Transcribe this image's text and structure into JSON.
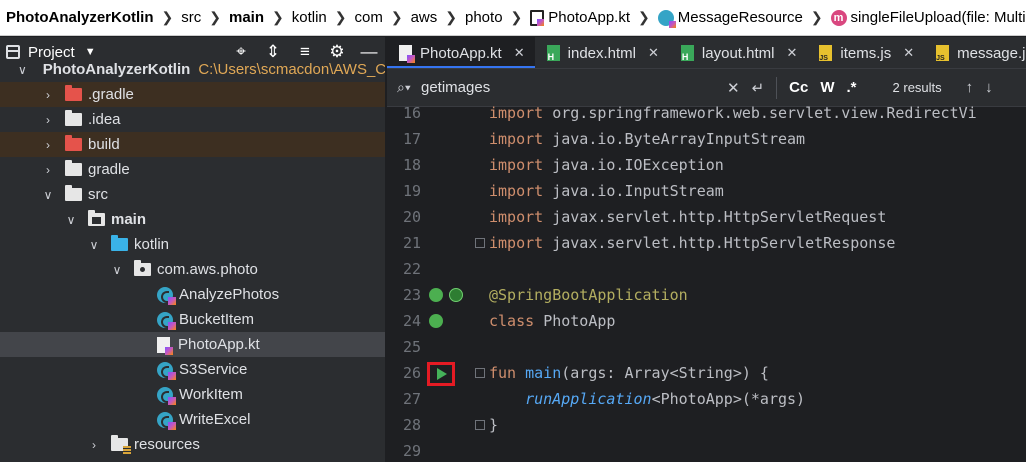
{
  "breadcrumb": {
    "project": "PhotoAnalyzerKotlin",
    "src": "src",
    "main": "main",
    "kotlin": "kotlin",
    "com": "com",
    "aws": "aws",
    "photo": "photo",
    "file": "PhotoApp.kt",
    "class": "MessageResource",
    "method_icon": "m",
    "method": "singleFileUpload(file: MultipartFile): M"
  },
  "project_panel": {
    "title": "Project",
    "tree": [
      {
        "label": "PhotoAnalyzerKotlin",
        "path": "C:\\Users\\scmacdon\\AWS_Co",
        "type": "root"
      },
      {
        "label": ".gradle",
        "type": "folder-red",
        "excluded": true
      },
      {
        "label": ".idea",
        "type": "folder-white"
      },
      {
        "label": "build",
        "type": "folder-red",
        "excluded": true
      },
      {
        "label": "gradle",
        "type": "folder-white"
      },
      {
        "label": "src",
        "type": "folder-white",
        "expanded": true
      },
      {
        "label": "main",
        "type": "folder-src",
        "expanded": true
      },
      {
        "label": "kotlin",
        "type": "folder-blue",
        "expanded": true
      },
      {
        "label": "com.aws.photo",
        "type": "folder-pkg",
        "expanded": true
      },
      {
        "label": "AnalyzePhotos",
        "type": "kt-class"
      },
      {
        "label": "BucketItem",
        "type": "kt-class"
      },
      {
        "label": "PhotoApp.kt",
        "type": "kt-file",
        "selected": true
      },
      {
        "label": "S3Service",
        "type": "kt-class"
      },
      {
        "label": "WorkItem",
        "type": "kt-class"
      },
      {
        "label": "WriteExcel",
        "type": "kt-class"
      },
      {
        "label": "resources",
        "type": "folder-res"
      }
    ]
  },
  "tabs": [
    {
      "label": "PhotoApp.kt",
      "icon": "kotlin-file-icon",
      "active": true
    },
    {
      "label": "index.html",
      "icon": "html-file-icon"
    },
    {
      "label": "layout.html",
      "icon": "html-file-icon"
    },
    {
      "label": "items.js",
      "icon": "js-file-icon"
    },
    {
      "label": "message.js",
      "icon": "js-file-icon"
    }
  ],
  "search": {
    "query": "getimages",
    "case_toggle": "Cc",
    "word_toggle": "W",
    "regex_toggle": ".*",
    "results": "2 results"
  },
  "code": {
    "lines": [
      {
        "n": "16",
        "parts": [
          [
            "kw",
            "import "
          ],
          [
            "",
            "org.springframework.web.servlet.view.RedirectVi"
          ]
        ]
      },
      {
        "n": "17",
        "parts": [
          [
            "kw",
            "import "
          ],
          [
            "",
            "java.io.ByteArrayInputStream"
          ]
        ]
      },
      {
        "n": "18",
        "parts": [
          [
            "kw",
            "import "
          ],
          [
            "",
            "java.io.IOException"
          ]
        ]
      },
      {
        "n": "19",
        "parts": [
          [
            "kw",
            "import "
          ],
          [
            "",
            "java.io.InputStream"
          ]
        ]
      },
      {
        "n": "20",
        "parts": [
          [
            "kw",
            "import "
          ],
          [
            "",
            "javax.servlet.http.HttpServletRequest"
          ]
        ]
      },
      {
        "n": "21",
        "parts": [
          [
            "kw",
            "import "
          ],
          [
            "",
            "javax.servlet.http.HttpServletResponse"
          ]
        ]
      },
      {
        "n": "22",
        "parts": []
      },
      {
        "n": "23",
        "parts": [
          [
            "ann",
            "@SpringBootApplication"
          ]
        ]
      },
      {
        "n": "24",
        "parts": [
          [
            "kw",
            "class "
          ],
          [
            "",
            "PhotoApp"
          ]
        ]
      },
      {
        "n": "25",
        "parts": []
      },
      {
        "n": "26",
        "parts": [
          [
            "kw",
            "fun "
          ],
          [
            "fn",
            "main"
          ],
          [
            "",
            "(args: Array<String>) {"
          ]
        ]
      },
      {
        "n": "27",
        "parts": [
          [
            "",
            "    "
          ],
          [
            "it fn",
            "runApplication"
          ],
          [
            "",
            "<PhotoApp>(*args)"
          ]
        ]
      },
      {
        "n": "28",
        "parts": [
          [
            "",
            "}"
          ]
        ]
      },
      {
        "n": "29",
        "parts": []
      }
    ]
  }
}
